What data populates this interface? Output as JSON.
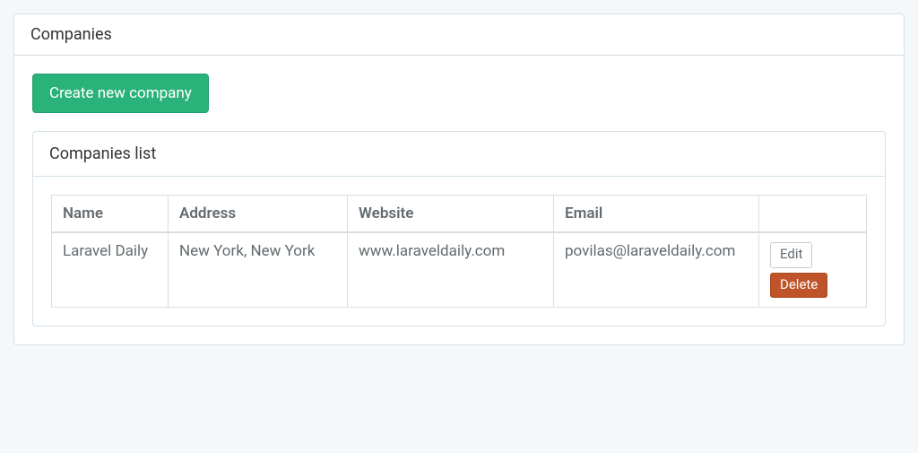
{
  "page": {
    "title": "Companies"
  },
  "actions": {
    "create_label": "Create new company"
  },
  "list_panel": {
    "title": "Companies list"
  },
  "table": {
    "headers": {
      "name": "Name",
      "address": "Address",
      "website": "Website",
      "email": "Email",
      "actions": ""
    },
    "rows": [
      {
        "name": "Laravel Daily",
        "address": "New York, New York",
        "website": "www.laraveldaily.com",
        "email": "povilas@laraveldaily.com",
        "edit_label": "Edit",
        "delete_label": "Delete"
      }
    ]
  }
}
